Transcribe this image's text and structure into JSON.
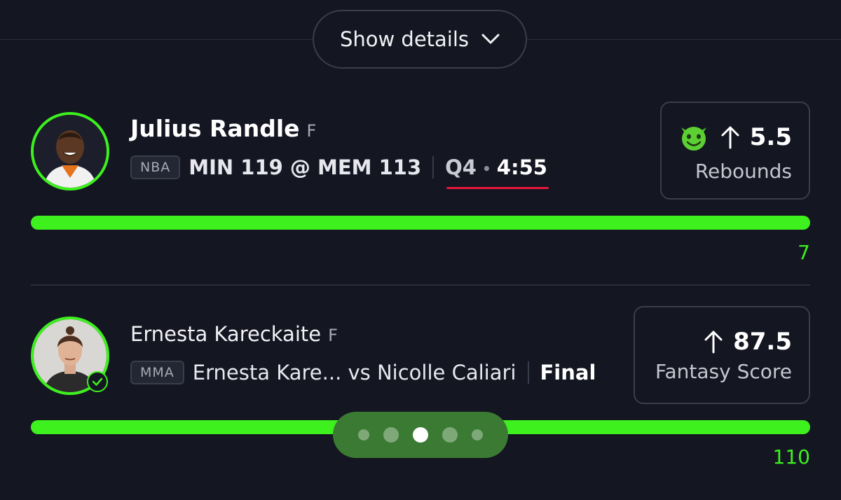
{
  "header": {
    "show_details_label": "Show details",
    "chevron_icon": "chevron-down-icon"
  },
  "colors": {
    "accent": "#3df01e",
    "background": "#141622",
    "live_underline": "#e5183a",
    "pager": "#3b7a32"
  },
  "picks": [
    {
      "player": "Julius Randle",
      "position": "F",
      "league": "NBA",
      "game": "MIN 119 @ MEM 113",
      "period": "Q4",
      "separator": "•",
      "clock": "4:55",
      "direction_icon": "arrow-up-icon",
      "badge_icon": "goblin-emoji-icon",
      "line": "5.5",
      "stat": "Rebounds",
      "actual": "7",
      "progress": 1.0
    },
    {
      "player": "Ernesta Kareckaite",
      "position": "F",
      "league": "MMA",
      "game": "Ernesta Kare... vs Nicolle Caliari",
      "status": "Final",
      "direction_icon": "arrow-up-icon",
      "line": "87.5",
      "stat": "Fantasy Score",
      "actual": "110",
      "progress": 1.0
    }
  ],
  "pagination": {
    "count": 5,
    "active_index": 2
  }
}
